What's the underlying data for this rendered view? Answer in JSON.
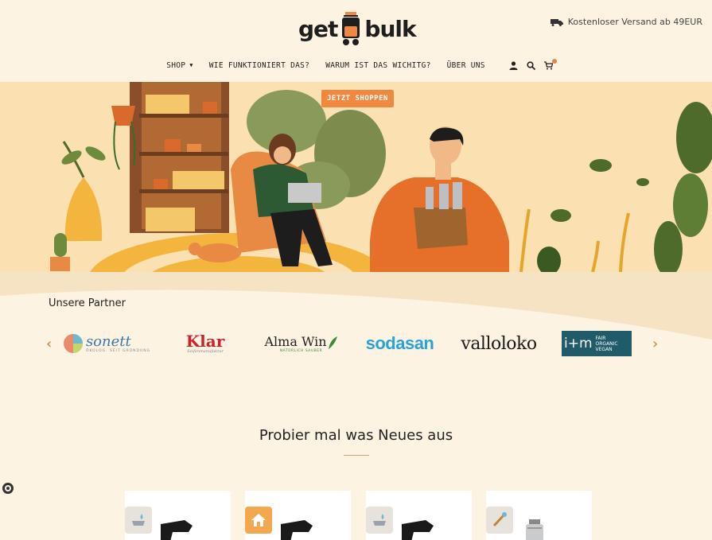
{
  "header": {
    "logo": {
      "word_left": "get",
      "word_right": "bulk"
    },
    "shipping_text": "Kostenloser Versand ab 49EUR",
    "nav": [
      {
        "label": "SHOP",
        "has_caret": true
      },
      {
        "label": "WIE FUNKTIONIERT DAS?"
      },
      {
        "label": "WARUM IST DAS WICHITG?"
      },
      {
        "label": "ÜBER UNS"
      }
    ],
    "icons": [
      "account-icon",
      "search-icon",
      "cart-icon"
    ]
  },
  "hero": {
    "cta_label": "JETZT SHOPPEN"
  },
  "partners": {
    "title": "Unsere Partner",
    "prev_arrow": "‹",
    "next_arrow": "›",
    "logos": [
      {
        "name": "sonett",
        "tagline": "ÖKOLOG. SEIT GRÜNDUNG"
      },
      {
        "name": "Klar",
        "tagline": "Seifenmanufaktur"
      },
      {
        "name": "Alma Win",
        "tagline": "NATÜRLICH SAUBER"
      },
      {
        "name": "sodasan"
      },
      {
        "name": "valloloko"
      },
      {
        "name": "i+m",
        "tagline": "FAIR ORGANIC VEGAN"
      }
    ]
  },
  "featured": {
    "title": "Probier mal was Neues aus"
  },
  "colors": {
    "background": "#fdf3e2",
    "hero_bg": "#fbe0b2",
    "accent": "#f0883f",
    "text": "#222222"
  }
}
